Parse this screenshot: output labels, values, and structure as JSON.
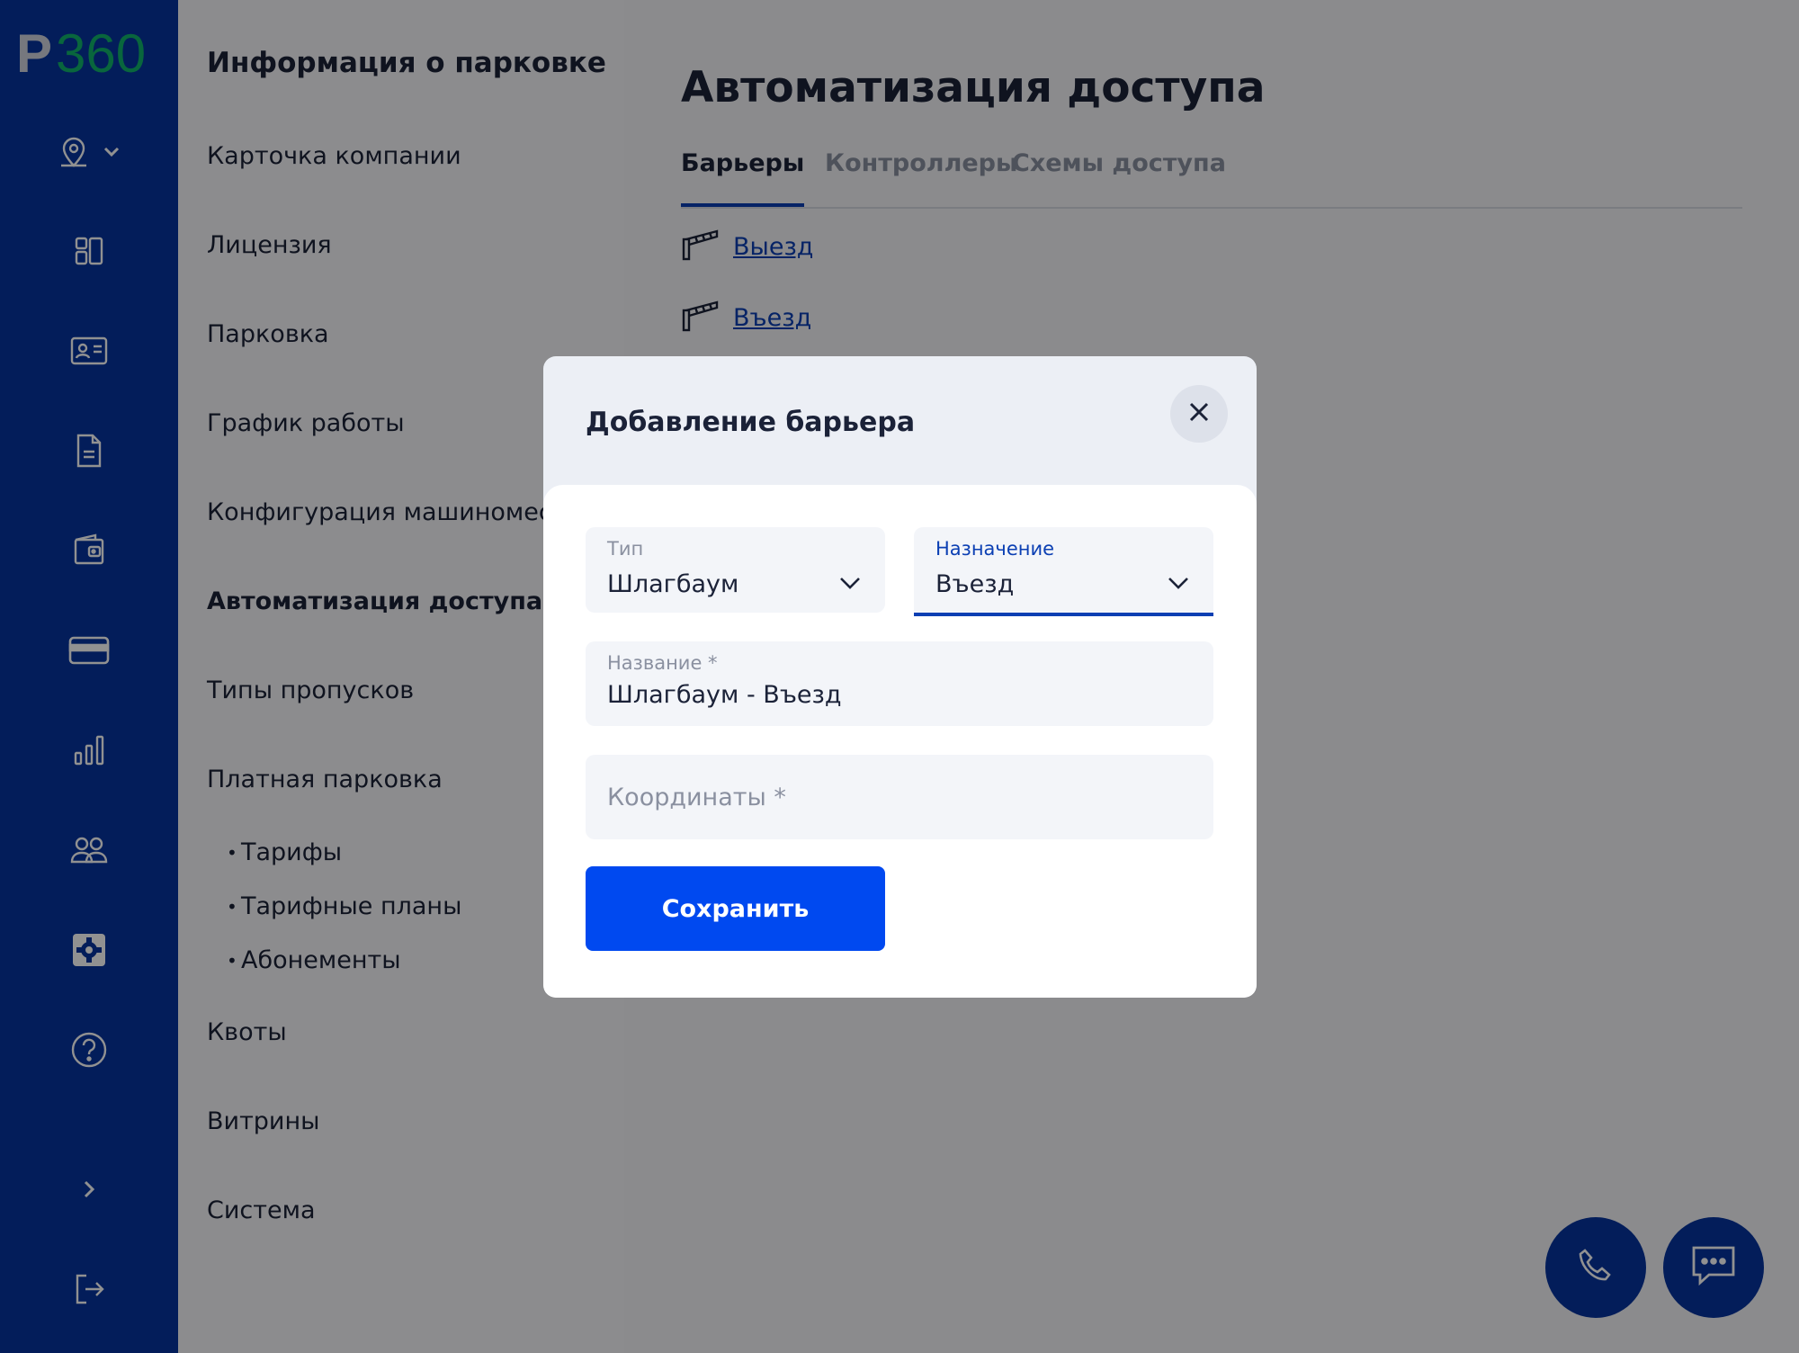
{
  "brand": {
    "logo_prefix": "P",
    "logo_suffix": "360",
    "logo_prefix_color": "#d0d4de",
    "logo_suffix_color": "#10b36b"
  },
  "colors": {
    "rail": "#06349f",
    "accent": "#0b3fb3",
    "button": "#0049f0"
  },
  "rail": {
    "icons": [
      "location-pin-icon",
      "dashboard-icon",
      "id-card-icon",
      "document-icon",
      "wallet-icon",
      "credit-card-icon",
      "bar-chart-icon",
      "users-icon",
      "settings-icon",
      "help-icon",
      "chevron-right-icon",
      "logout-icon"
    ],
    "active_icon": "settings-icon"
  },
  "menu": {
    "title": "Информация о парковке",
    "items": [
      {
        "label": "Карточка компании"
      },
      {
        "label": "Лицензия"
      },
      {
        "label": "Парковка"
      },
      {
        "label": "График работы"
      },
      {
        "label": "Конфигурация машиномест"
      },
      {
        "label": "Автоматизация доступа",
        "active": true
      },
      {
        "label": "Типы пропусков"
      },
      {
        "label": "Платная парковка"
      }
    ],
    "subitems": [
      {
        "label": "Тарифы"
      },
      {
        "label": "Тарифные планы"
      },
      {
        "label": "Абонементы"
      }
    ],
    "items_after": [
      {
        "label": "Квоты"
      },
      {
        "label": "Витрины"
      },
      {
        "label": "Система"
      }
    ]
  },
  "main": {
    "title": "Автоматизация доступа",
    "tabs": [
      {
        "label": "Барьеры",
        "active": true
      },
      {
        "label": "Контроллеры"
      },
      {
        "label": "Схемы доступа"
      }
    ],
    "barriers": [
      {
        "label": "Выезд",
        "icon": "barrier-gate-icon"
      },
      {
        "label": "Въезд",
        "icon": "barrier-gate-icon"
      }
    ]
  },
  "fabs": {
    "phone_icon": "phone-icon",
    "chat_icon": "chat-icon"
  },
  "modal": {
    "title": "Добавление барьера",
    "close_icon": "close-icon",
    "type_field": {
      "label": "Тип",
      "value": "Шлагбаум"
    },
    "purpose_field": {
      "label": "Назначение",
      "value": "Въезд"
    },
    "name_field": {
      "label": "Название *",
      "value": "Шлагбаум - Въезд"
    },
    "coords_field": {
      "placeholder": "Координаты *",
      "value": ""
    },
    "save_label": "Сохранить"
  }
}
